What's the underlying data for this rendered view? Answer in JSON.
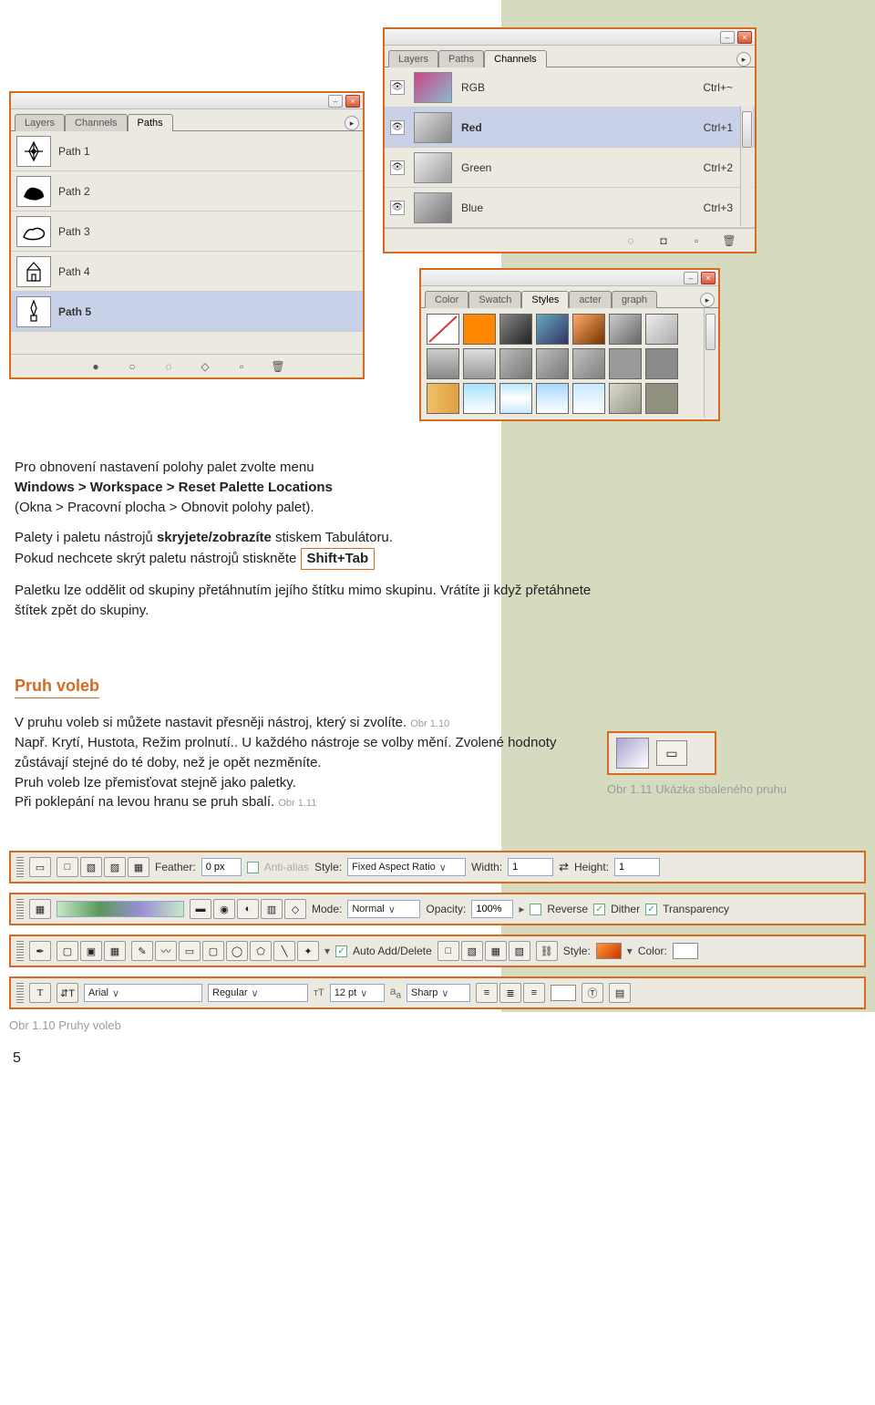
{
  "paths_palette": {
    "tabs": [
      "Layers",
      "Channels",
      "Paths"
    ],
    "active_tab": 2,
    "items": [
      {
        "name": "Path 1"
      },
      {
        "name": "Path 2"
      },
      {
        "name": "Path 3"
      },
      {
        "name": "Path 4"
      },
      {
        "name": "Path 5",
        "active": true
      }
    ],
    "footer_icons": [
      "fill-circle",
      "stroke-circle",
      "load-sel",
      "make-path",
      "new",
      "trash"
    ]
  },
  "channels_palette": {
    "tabs": [
      "Layers",
      "Paths",
      "Channels"
    ],
    "active_tab": 2,
    "items": [
      {
        "name": "RGB",
        "shortcut": "Ctrl+~",
        "visible": true
      },
      {
        "name": "Red",
        "shortcut": "Ctrl+1",
        "visible": true,
        "active": true
      },
      {
        "name": "Green",
        "shortcut": "Ctrl+2",
        "visible": true
      },
      {
        "name": "Blue",
        "shortcut": "Ctrl+3",
        "visible": true
      }
    ],
    "footer_icons": [
      "load-sel",
      "save-sel",
      "new",
      "trash"
    ]
  },
  "styles_palette": {
    "tabs": [
      "Color",
      "Swatch",
      "Styles",
      "acter",
      "graph"
    ],
    "active_tab": 2,
    "swatches": [
      "none",
      "#ff8800",
      "linear-gradient(135deg,#888,#222)",
      "linear-gradient(135deg,#6ab,#336)",
      "linear-gradient(135deg,#fa6,#730)",
      "linear-gradient(135deg,#ccc,#666)",
      "linear-gradient(135deg,#eee,#aaa)",
      "linear-gradient(#ccc,#888)",
      "linear-gradient(#ddd,#999)",
      "linear-gradient(135deg,#bbb,#777)",
      "linear-gradient(135deg,#bdbdbd,#787878)",
      "linear-gradient(135deg,#c0c0c0,#808080)",
      "#999",
      "#8a8a8a",
      "linear-gradient(90deg,#f0c06a,#e0a040)",
      "linear-gradient(#a8e2ff,#fff)",
      "linear-gradient(#b8e8ff,#fff,#c8e8ff)",
      "linear-gradient(#a8d8ff,#fff)",
      "linear-gradient(#c8e8ff,#fff)",
      "linear-gradient(135deg,#d8d8cc,#989888)",
      "#909080"
    ]
  },
  "text": {
    "p1a": "Pro obnovení nastavení polohy palet zvolte menu",
    "p1b": "Windows > Workspace > Reset Palette Locations",
    "p1c": "(Okna > Pracovní plocha > Obnovit polohy palet).",
    "p2a": "Palety i paletu nástrojů ",
    "p2b": "skryjete/zobrazíte",
    "p2c": " stiskem Tabulátoru.",
    "p3a": "Pokud nechcete skrýt paletu nástrojů stiskněte ",
    "p3b": "Shift+Tab",
    "p4": "Paletku lze oddělit od skupiny přetáhnutím jejího štítku mimo skupinu. Vrátíte ji když přetáhnete štítek zpět do skupiny.",
    "section_title": "Pruh voleb",
    "p5a": "V pruhu voleb si můžete nastavit přesněji nástroj, který si zvolíte. ",
    "p5ref": "Obr 1.10",
    "p6": "Např. Krytí, Hustota, Režim prolnutí.. U každého nástroje se volby mění. Zvolené hodnoty zůstávají stejné do té doby, než je opět nezměníte.",
    "p7": "Pruh voleb lze přemisťovat stejně jako paletky.",
    "p8a": "Při poklepání na levou hranu se pruh sbalí. ",
    "p8ref": "Obr 1.11",
    "caption_collapsed": "Obr 1.11  Ukázka sbaleného pruhu",
    "caption_bars": "Obr 1.10  Pruhy voleb",
    "page_number": "5"
  },
  "optbar1": {
    "feather_label": "Feather:",
    "feather_value": "0 px",
    "antialias": "Anti-alias",
    "style_label": "Style:",
    "style_value": "Fixed Aspect Ratio",
    "width_label": "Width:",
    "width_value": "1",
    "height_label": "Height:",
    "height_value": "1"
  },
  "optbar2": {
    "mode_label": "Mode:",
    "mode_value": "Normal",
    "opacity_label": "Opacity:",
    "opacity_value": "100%",
    "reverse": "Reverse",
    "dither": "Dither",
    "transparency": "Transparency"
  },
  "optbar3": {
    "auto": "Auto Add/Delete",
    "style_label": "Style:",
    "color_label": "Color:"
  },
  "optbar4": {
    "font": "Arial",
    "weight": "Regular",
    "size": "12 pt",
    "aa": "Sharp"
  }
}
